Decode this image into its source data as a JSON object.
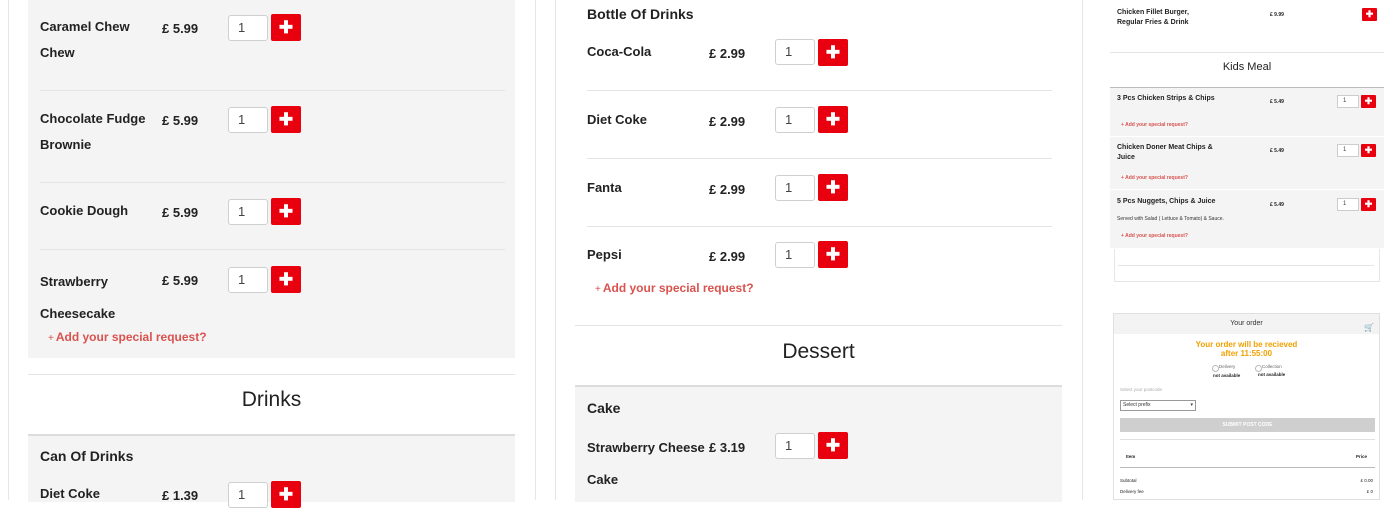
{
  "col1": {
    "items": [
      {
        "name_line1": "Caramel Chew",
        "name_line2": "Chew",
        "price": "£ 5.99",
        "qty": "1"
      },
      {
        "name_line1": "Chocolate Fudge",
        "name_line2": "Brownie",
        "price": "£ 5.99",
        "qty": "1"
      },
      {
        "name_line1": "Cookie Dough",
        "name_line2": "",
        "price": "£ 5.99",
        "qty": "1"
      },
      {
        "name_line1": "Strawberry",
        "name_line2": "Cheesecake",
        "price": "£ 5.99",
        "qty": "1"
      }
    ],
    "special_request": "Add your special request?",
    "section_title": "Drinks",
    "sub_title": "Can Of Drinks",
    "drink_item": {
      "name": "Diet Coke",
      "price": "£ 1.39",
      "qty": "1"
    }
  },
  "col2": {
    "sub_title": "Bottle Of Drinks",
    "items": [
      {
        "name": "Coca-Cola",
        "price": "£ 2.99",
        "qty": "1"
      },
      {
        "name": "Diet Coke",
        "price": "£ 2.99",
        "qty": "1"
      },
      {
        "name": "Fanta",
        "price": "£ 2.99",
        "qty": "1"
      },
      {
        "name": "Pepsi",
        "price": "£ 2.99",
        "qty": "1"
      }
    ],
    "special_request": "Add your special request?",
    "section_title": "Dessert",
    "cake_title": "Cake",
    "cake_item": {
      "name_line1": "Strawberry Cheese",
      "name_line2": "Cake",
      "price": "£ 3.19",
      "qty": "1"
    }
  },
  "col3": {
    "top_item": {
      "name": "Chicken Fillet Burger, Regular Fries & Drink",
      "price": "£ 9.99"
    },
    "section_title": "Kids Meal",
    "items": [
      {
        "name": "3 Pcs Chicken Strips & Chips",
        "desc": "",
        "price": "£ 5.49",
        "qty": "1",
        "special": "Add your special request?"
      },
      {
        "name": "Chicken Doner Meat Chips & Juice",
        "desc": "",
        "price": "£ 5.49",
        "qty": "1",
        "special": "Add your special request?"
      },
      {
        "name": "5 Pcs Nuggets, Chips & Juice",
        "desc": "Served with Salad ( Lettuce & Tomato) & Sauce.",
        "price": "£ 5.49",
        "qty": "1",
        "special": "Add your special request?"
      }
    ]
  },
  "order": {
    "title": "Your order",
    "message_line1": "Your order will be recieved",
    "message_line2": "after 11:55:00",
    "delivery_label": "Delivery",
    "delivery_status": "not available",
    "collection_label": "Collection",
    "collection_status": "not available",
    "postcode_label": "Select your postcode",
    "prefix_select": "Select prefix",
    "submit_label": "SUBMIT POST CODE",
    "col_item": "Item",
    "col_price": "Price",
    "subtotal_label": "Subtotal",
    "subtotal_value": "£ 0.00",
    "delivery_fee_label": "Delivery fee",
    "delivery_fee_value": "£ 0"
  },
  "colors": {
    "accent": "#e8000e",
    "link": "#d9534f",
    "message": "#f0a000"
  },
  "icons": {
    "add": "plus-icon",
    "cart": "cart-icon"
  }
}
